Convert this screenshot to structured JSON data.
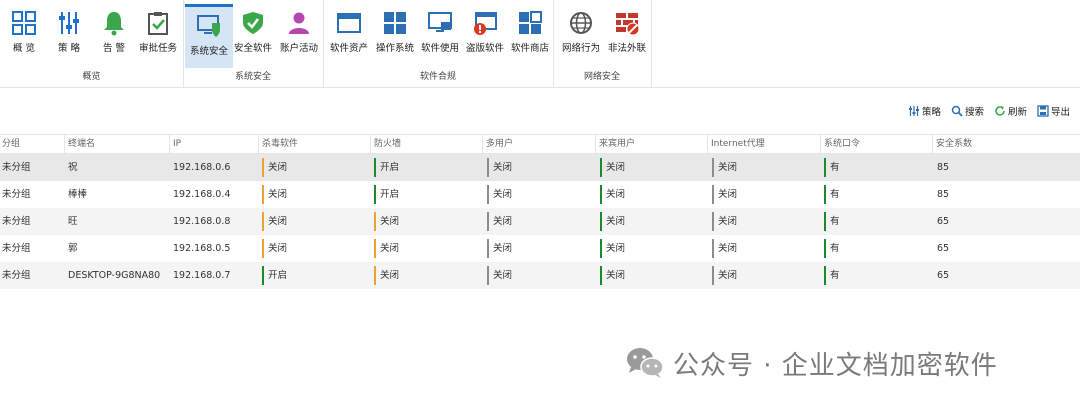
{
  "ribbon": {
    "groups": [
      {
        "label": "概览"
      },
      {
        "label": "系统安全"
      },
      {
        "label": "软件合规"
      },
      {
        "label": "网络安全"
      }
    ],
    "buttons": [
      {
        "label": "概 览",
        "icon": "grid-icon"
      },
      {
        "label": "策 略",
        "icon": "sliders-icon"
      },
      {
        "label": "告 警",
        "icon": "bell-icon"
      },
      {
        "label": "审批任务",
        "icon": "clipboard-check-icon"
      },
      {
        "label": "系统安全",
        "icon": "monitor-shield-icon"
      },
      {
        "label": "安全软件",
        "icon": "shield-check-icon"
      },
      {
        "label": "账户活动",
        "icon": "user-icon"
      },
      {
        "label": "软件资产",
        "icon": "window-icon"
      },
      {
        "label": "操作系统",
        "icon": "windows-logo-icon"
      },
      {
        "label": "软件使用",
        "icon": "monitor-icon"
      },
      {
        "label": "盗版软件",
        "icon": "window-alert-icon"
      },
      {
        "label": "软件商店",
        "icon": "apps-icon"
      },
      {
        "label": "网络行为",
        "icon": "globe-icon"
      },
      {
        "label": "非法外联",
        "icon": "firewall-icon"
      }
    ]
  },
  "toolbar": {
    "strategy": "策略",
    "search": "搜索",
    "refresh": "刷新",
    "export": "导出"
  },
  "table": {
    "columns": [
      "分组",
      "终端名",
      "IP",
      "杀毒软件",
      "防火墙",
      "多用户",
      "来宾用户",
      "Internet代理",
      "系统口令",
      "安全系数"
    ],
    "rows": [
      {
        "group": "未分组",
        "name": "祝",
        "ip": "192.168.0.6",
        "antivirus": "关闭",
        "firewall": "开启",
        "multiuser": "关闭",
        "guest": "关闭",
        "proxy": "关闭",
        "password": "有",
        "score": "85"
      },
      {
        "group": "未分组",
        "name": "棒棒",
        "ip": "192.168.0.4",
        "antivirus": "关闭",
        "firewall": "开启",
        "multiuser": "关闭",
        "guest": "关闭",
        "proxy": "关闭",
        "password": "有",
        "score": "85"
      },
      {
        "group": "未分组",
        "name": "旺",
        "ip": "192.168.0.8",
        "antivirus": "关闭",
        "firewall": "关闭",
        "multiuser": "关闭",
        "guest": "关闭",
        "proxy": "关闭",
        "password": "有",
        "score": "65"
      },
      {
        "group": "未分组",
        "name": "郭",
        "ip": "192.168.0.5",
        "antivirus": "关闭",
        "firewall": "关闭",
        "multiuser": "关闭",
        "guest": "关闭",
        "proxy": "关闭",
        "password": "有",
        "score": "65"
      },
      {
        "group": "未分组",
        "name": "DESKTOP-9G8NA80",
        "ip": "192.168.0.7",
        "antivirus": "开启",
        "firewall": "关闭",
        "multiuser": "关闭",
        "guest": "关闭",
        "proxy": "关闭",
        "password": "有",
        "score": "65"
      }
    ]
  },
  "watermark": {
    "text": "公众号 · 企业文档加密软件"
  },
  "colors": {
    "accent": "#1e72c7",
    "green": "#1a8a2a",
    "orange": "#f0a030",
    "gray": "#8c8c8c"
  }
}
